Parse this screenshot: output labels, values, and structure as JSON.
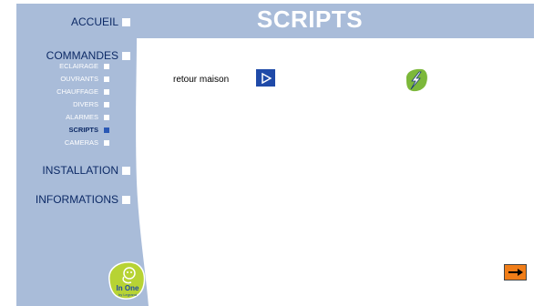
{
  "header": {
    "title": "SCRIPTS"
  },
  "sidebar": {
    "accueil": "ACCUEIL",
    "commandes": "COMMANDES",
    "sub_items": [
      {
        "label": "ECLAIRAGE"
      },
      {
        "label": "OUVRANTS"
      },
      {
        "label": "CHAUFFAGE"
      },
      {
        "label": "DIVERS"
      },
      {
        "label": "ALARMES"
      },
      {
        "label": "SCRIPTS",
        "active": true
      },
      {
        "label": "CAMERAS"
      }
    ],
    "installation": "INSTALLATION",
    "informations": "INFORMATIONS"
  },
  "main": {
    "script_label": "retour maison",
    "play_icon": "play-icon",
    "run_icon": "lightning-icon",
    "next_icon": "arrow-right-icon"
  },
  "logo": {
    "text": "In One",
    "subtext": "by Legrand"
  },
  "colors": {
    "sidebar_blue": "#a9bcd9",
    "nav_text": "#0d2a66",
    "play_button": "#1f4aa8",
    "lightning_green": "#7cb83a",
    "next_button": "#f07d18"
  }
}
